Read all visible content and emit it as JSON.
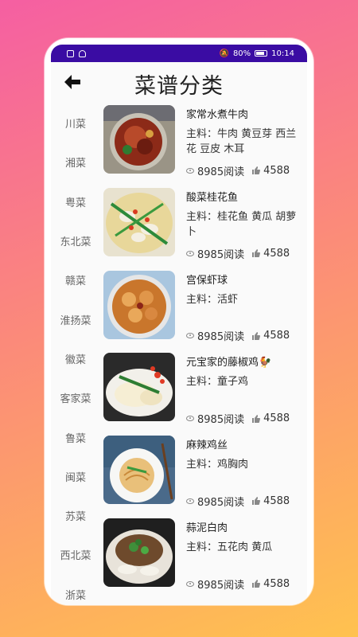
{
  "status_bar": {
    "battery": "80%",
    "time": "10:14"
  },
  "header": {
    "title": "菜谱分类"
  },
  "categories": [
    "川菜",
    "湘菜",
    "粤菜",
    "东北菜",
    "赣菜",
    "淮扬菜",
    "徽菜",
    "客家菜",
    "鲁菜",
    "闽菜",
    "苏菜",
    "西北菜",
    "浙菜"
  ],
  "recipes": [
    {
      "name": "家常水煮牛肉",
      "ingredients": "主料：牛肉 黄豆芽 西兰花 豆皮 木耳",
      "reads": "8985阅读",
      "likes": "4588"
    },
    {
      "name": "酸菜桂花鱼",
      "ingredients": "主料：桂花鱼 黄瓜 胡萝卜",
      "reads": "8985阅读",
      "likes": "4588"
    },
    {
      "name": "宫保虾球",
      "ingredients": "主料：活虾",
      "reads": "8985阅读",
      "likes": "4588"
    },
    {
      "name": "元宝家的藤椒鸡🐓",
      "ingredients": "主料：童子鸡",
      "reads": "8985阅读",
      "likes": "4588"
    },
    {
      "name": "麻辣鸡丝",
      "ingredients": "主料：鸡胸肉",
      "reads": "8985阅读",
      "likes": "4588"
    },
    {
      "name": "蒜泥白肉",
      "ingredients": "主料：五花肉 黄瓜",
      "reads": "8985阅读",
      "likes": "4588"
    }
  ],
  "colors": {
    "status_bar": "#3a0ca3",
    "gradient_start": "#f55fa2",
    "gradient_end": "#ffc24f"
  }
}
